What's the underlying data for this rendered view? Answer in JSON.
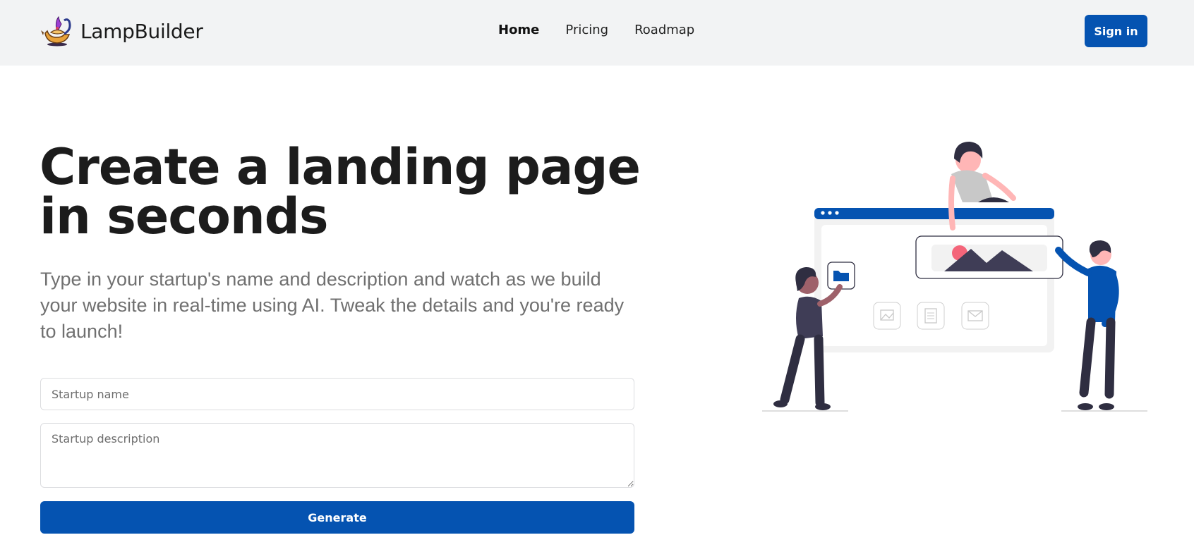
{
  "navbar": {
    "brand_name": "LampBuilder",
    "brand_logo_icon": "magic-lamp-icon",
    "links": [
      {
        "label": "Home",
        "active": true
      },
      {
        "label": "Pricing",
        "active": false
      },
      {
        "label": "Roadmap",
        "active": false
      }
    ],
    "signin_label": "Sign in"
  },
  "hero": {
    "title": "Create a landing page in seconds",
    "subtitle": "Type in your startup's name and description and watch as we build your website in real-time using AI. Tweak the details and you're ready to launch!",
    "form": {
      "name_placeholder": "Startup name",
      "name_value": "",
      "description_placeholder": "Startup description",
      "description_value": "",
      "submit_label": "Generate"
    },
    "illustration_icon": "team-building-website-illustration"
  },
  "colors": {
    "primary": "#0553b1",
    "navbar_bg": "#f2f3f4",
    "text_dark": "#1c1c1c",
    "text_muted": "#707070",
    "accent_pink": "#f4657a",
    "figure_dark": "#2f2e41"
  }
}
